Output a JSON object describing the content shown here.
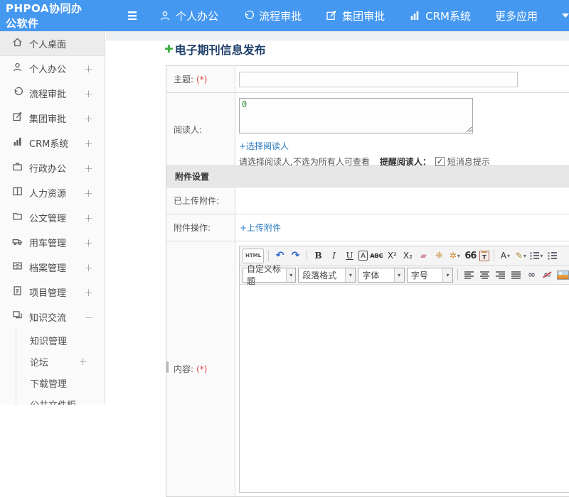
{
  "header": {
    "logo": "PHPOA协同办公软件",
    "nav": [
      {
        "label": "个人办公",
        "icon": "person-icon"
      },
      {
        "label": "流程审批",
        "icon": "workflow-icon"
      },
      {
        "label": "集团审批",
        "icon": "edit-icon"
      },
      {
        "label": "CRM系统",
        "icon": "chart-icon"
      },
      {
        "label": "更多应用",
        "icon": "dropdown-caret-icon"
      }
    ]
  },
  "sidebar": {
    "items": [
      {
        "label": "个人桌面",
        "icon": "home-icon",
        "active": true
      },
      {
        "label": "个人办公",
        "icon": "person-icon",
        "expand": "+"
      },
      {
        "label": "流程审批",
        "icon": "workflow-icon",
        "expand": "+"
      },
      {
        "label": "集团审批",
        "icon": "edit-icon",
        "expand": "+"
      },
      {
        "label": "CRM系统",
        "icon": "chart-icon",
        "expand": "+"
      },
      {
        "label": "行政办公",
        "icon": "briefcase-icon",
        "expand": "+"
      },
      {
        "label": "人力资源",
        "icon": "book-icon",
        "expand": "+"
      },
      {
        "label": "公文管理",
        "icon": "folder-icon",
        "expand": "+"
      },
      {
        "label": "用车管理",
        "icon": "car-icon",
        "expand": "+"
      },
      {
        "label": "档案管理",
        "icon": "archive-icon",
        "expand": "+"
      },
      {
        "label": "项目管理",
        "icon": "clipboard-icon",
        "expand": "+"
      },
      {
        "label": "知识交流",
        "icon": "chat-icon",
        "expand": "−",
        "expanded": true
      }
    ],
    "subitems": [
      {
        "label": "知识管理"
      },
      {
        "label": "论坛",
        "expand": "+"
      },
      {
        "label": "下载管理"
      },
      {
        "label": "公共文件柜"
      }
    ]
  },
  "main": {
    "page_title": "电子期刊信息发布",
    "form": {
      "subject_label": "主题:",
      "required_mark": "(*)",
      "readers_label": "阅读人:",
      "readers_value": "0",
      "select_readers_link": "+选择阅读人",
      "readers_hint": "请选择阅读人,不选为所有人可查看",
      "remind_label": "提醒阅读人：",
      "remind_checked": true,
      "sms_label": "短消息提示",
      "attach_section": "附件设置",
      "uploaded_label": "已上传附件:",
      "attach_op_label": "附件操作:",
      "upload_link": "+上传附件",
      "content_label": "内容:"
    },
    "editor": {
      "toolbar1": {
        "html": "HTML",
        "bold": "B",
        "italic": "I",
        "underline": "U",
        "font_box": "A",
        "strike": "ABC",
        "sup": "X²",
        "sub": "X₂",
        "quote": "66",
        "paste": "T",
        "color": "A"
      },
      "toolbar2": {
        "style": "自定义标题",
        "format": "段落格式",
        "font": "字体",
        "size": "字号"
      }
    }
  },
  "icons": {
    "plus": "✚",
    "undo": "↶",
    "redo": "↷",
    "eraser": "▰",
    "brush": "❈",
    "wand": "✲",
    "pen": "✎",
    "link": "∞",
    "unlink": "∞",
    "caret": "▾",
    "check": "✓"
  },
  "colors": {
    "header_blue": "#4598f0",
    "title_navy": "#20406b",
    "link_blue": "#2779c0",
    "plus_green": "#3fae46",
    "required_red": "#e04545",
    "section_gray": "#e7e7e7",
    "reader_count_green": "#2f8a35"
  }
}
